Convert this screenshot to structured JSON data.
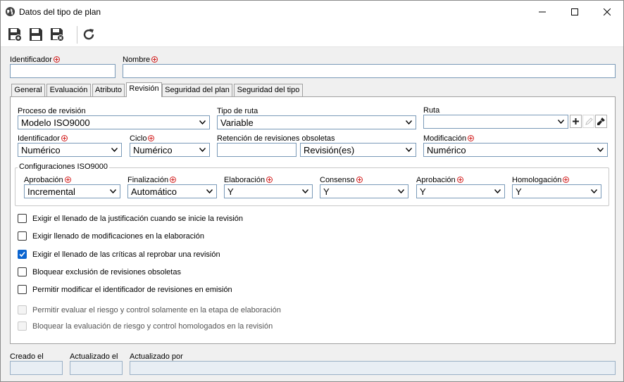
{
  "window": {
    "title": "Datos del tipo de plan"
  },
  "fields": {
    "identificador_label": "Identificador",
    "identificador_value": "",
    "nombre_label": "Nombre",
    "nombre_value": ""
  },
  "tabs": [
    {
      "label": "General"
    },
    {
      "label": "Evaluación"
    },
    {
      "label": "Atributo"
    },
    {
      "label": "Revisión"
    },
    {
      "label": "Seguridad del plan"
    },
    {
      "label": "Seguridad del tipo"
    }
  ],
  "revision": {
    "proceso_label": "Proceso de revisión",
    "proceso_value": "Modelo ISO9000",
    "tipo_ruta_label": "Tipo de ruta",
    "tipo_ruta_value": "Variable",
    "ruta_label": "Ruta",
    "ruta_value": "",
    "identificador_label": "Identificador",
    "identificador_value": "Numérico",
    "ciclo_label": "Ciclo",
    "ciclo_value": "Numérico",
    "retencion_label": "Retención de revisiones obsoletas",
    "retencion_number": "",
    "retencion_unit": "Revisión(es)",
    "modificacion_label": "Modificación",
    "modificacion_value": "Numérico"
  },
  "iso9000": {
    "title": "Configuraciones ISO9000",
    "aprobacion1_label": "Aprobación",
    "aprobacion1_value": "Incremental",
    "finalizacion_label": "Finalización",
    "finalizacion_value": "Automático",
    "elaboracion_label": "Elaboración",
    "elaboracion_value": "Y",
    "consenso_label": "Consenso",
    "consenso_value": "Y",
    "aprobacion2_label": "Aprobación",
    "aprobacion2_value": "Y",
    "homologacion_label": "Homologación",
    "homologacion_value": "Y"
  },
  "checkboxes": [
    {
      "label": "Exigir el llenado de la justificación cuando se inicie la revisión",
      "checked": false,
      "disabled": false
    },
    {
      "label": "Exigir llenado de modificaciones en la elaboración",
      "checked": false,
      "disabled": false
    },
    {
      "label": "Exigir el llenado de las críticas al reprobar una revisión",
      "checked": true,
      "disabled": false
    },
    {
      "label": "Bloquear exclusión de revisiones obsoletas",
      "checked": false,
      "disabled": false
    },
    {
      "label": "Permitir modificar el identificador de revisiones en emisión",
      "checked": false,
      "disabled": false
    },
    {
      "label": "Permitir evaluar el riesgo y control solamente en la etapa de elaboración",
      "checked": false,
      "disabled": true
    },
    {
      "label": "Bloquear la evaluación de riesgo y control homologados en la revisión",
      "checked": false,
      "disabled": true
    }
  ],
  "footer": {
    "creado_label": "Creado el",
    "creado_value": "",
    "actualizado_label": "Actualizado el",
    "actualizado_value": "",
    "actualizado_por_label": "Actualizado por",
    "actualizado_por_value": ""
  },
  "colors": {
    "accent": "#0a64d0",
    "required": "#d32020",
    "field_border": "#7a9ab8"
  }
}
